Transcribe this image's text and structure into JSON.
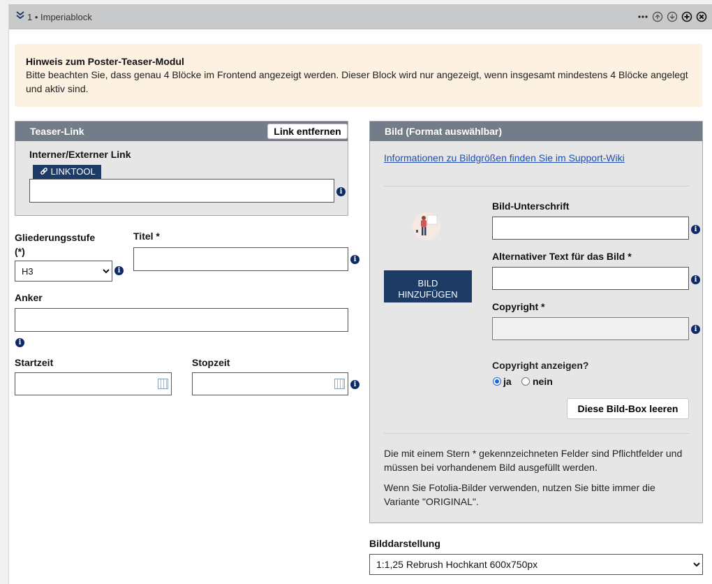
{
  "topbar": {
    "title": "1 • Imperiablock",
    "icons": [
      "collapse-chevron-icon",
      "more-icon",
      "move-up-icon",
      "move-down-icon",
      "add-icon",
      "close-icon"
    ]
  },
  "notice": {
    "heading": "Hinweis zum Poster-Teaser-Modul",
    "text": "Bitte beachten Sie, dass genau 4 Blöcke im Frontend angezeigt werden. Dieser Block wird nur angezeigt, wenn insgesamt mindestens 4 Blöcke angelegt und aktiv sind."
  },
  "teaser": {
    "header": "Teaser-Link",
    "remove_label": "Link entfernen",
    "link_label": "Interner/Externer Link",
    "linktool_label": "LINKTOOL",
    "link_value": ""
  },
  "form": {
    "level_label": "Gliederungsstufe",
    "level_required": "(*)",
    "level_value": "H3",
    "title_label": "Titel *",
    "title_value": "",
    "anchor_label": "Anker",
    "anchor_value": "",
    "start_label": "Startzeit",
    "stop_label": "Stopzeit"
  },
  "bild": {
    "header": "Bild (Format auswählbar)",
    "wiki_link": "Informationen zu Bildgrößen finden Sie im Support-Wiki",
    "add_button_line1": "BILD",
    "add_button_line2": "HINZUFÜGEN",
    "caption_label": "Bild-Unterschrift",
    "alt_label": "Alternativer Text für das Bild *",
    "copyright_label": "Copyright *",
    "show_copyright_label": "Copyright anzeigen?",
    "radio_yes": "ja",
    "radio_no": "nein",
    "radio_selected": "ja",
    "clear_button": "Diese Bild-Box leeren",
    "hint1": "Die mit einem Stern * gekennzeichneten Felder sind Pflichtfelder und müssen bei vorhandenem Bild ausgefüllt werden.",
    "hint2": "Wenn Sie Fotolia-Bilder verwenden, nutzen Sie bitte immer die Variante \"ORIGINAL\"."
  },
  "display": {
    "label": "Bilddarstellung",
    "value": "1:1,25 Rebrush Hochkant 600x750px"
  }
}
